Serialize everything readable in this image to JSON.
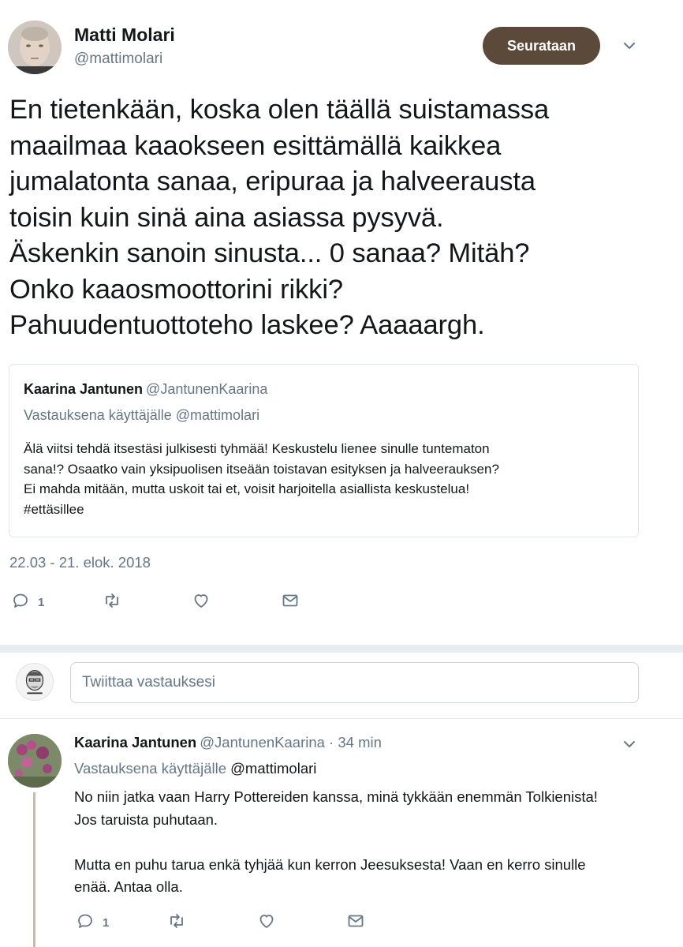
{
  "tweet": {
    "author_name": "Matti Molari",
    "author_handle": "@mattimolari",
    "follow_label": "Seurataan",
    "text": "En tietenkään, koska olen täällä suistamassa\nmaailmaa kaaokseen esittämällä kaikkea\njumalatonta sanaa, eripuraa ja halveerausta\ntoisin kuin sinä aina asiassa pysyvä.\nÄskenkin sanoin sinusta... 0 sanaa? Mitäh?\nOnko kaaosmoottorini rikki?\nPahuudentuottoteho laskee? Aaaaargh.",
    "date": "22.03 - 21. elok. 2018",
    "reply_count": "1"
  },
  "quote": {
    "author_name": "Kaarina Jantunen",
    "author_handle": "@JantunenKaarina",
    "reply_context": "Vastauksena käyttäjälle @mattimolari",
    "text": "Älä viitsi tehdä itsestäsi julkisesti  tyhmää! Keskustelu lienee sinulle tuntematon\nsana!? Osaatko vain yksipuolisen itseään toistavan esityksen ja halveerauksen?\nEi mahda mitään, mutta uskoit tai et, voisit harjoitella asiallista keskustelua!\n#ettäsillee"
  },
  "compose": {
    "placeholder": "Twiittaa vastauksesi"
  },
  "reply": {
    "author_name": "Kaarina Jantunen",
    "author_handle": "@JantunenKaarina",
    "time": " · 34 min",
    "reply_prefix": "Vastauksena käyttäjälle ",
    "reply_user": "@mattimolari",
    "text": "No niin jatka vaan Harry Pottereiden kanssa, minä tykkään enemmän Tolkienista!\nJos taruista puhutaan.\n\nMutta en puhu tarua enkä tyhjää kun kerron Jeesuksesta!  Vaan en kerro sinulle\nenää. Antaa olla.",
    "reply_count": "1"
  },
  "colors": {
    "follow_button": "#5b4a3a",
    "secondary_text": "#657786",
    "divider": "#e6ecf0"
  }
}
